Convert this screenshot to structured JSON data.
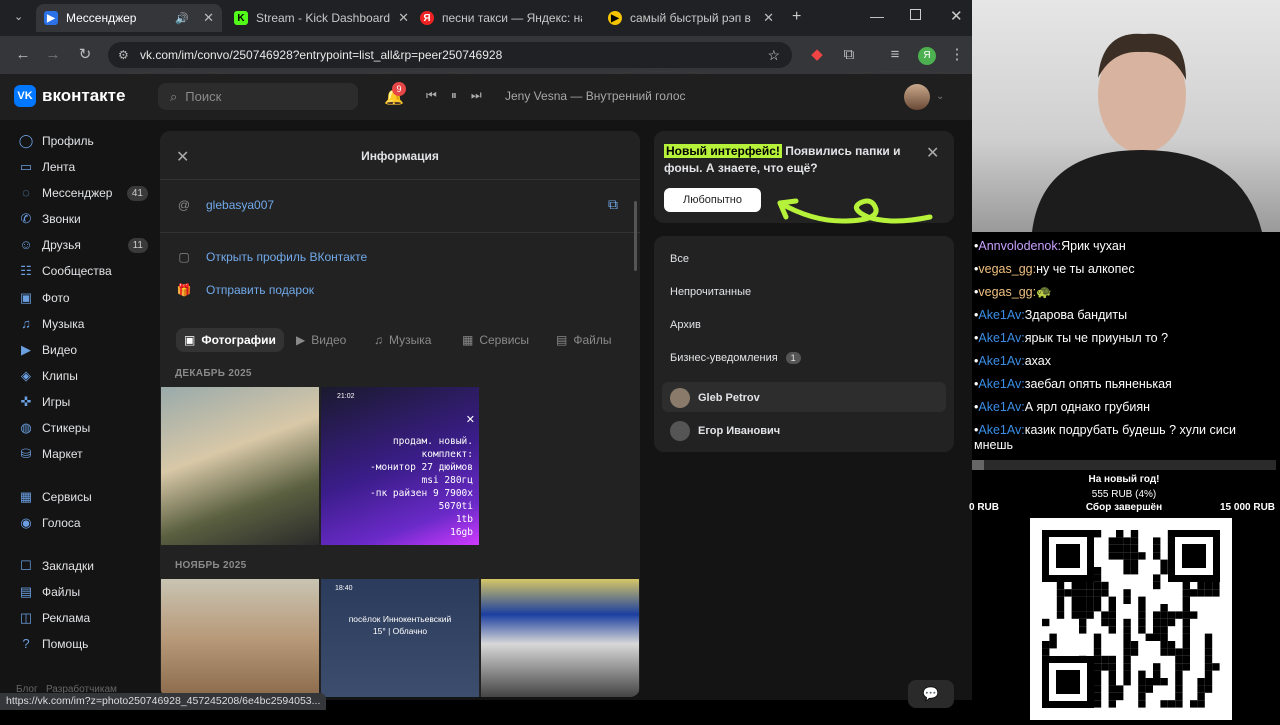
{
  "browser": {
    "tabs": [
      {
        "label": "Мессенджер",
        "color": "#2a72e6",
        "glyph": "▶"
      },
      {
        "label": "Stream - Kick Dashboard",
        "color": "#53fc18",
        "glyph": "K"
      },
      {
        "label": "песни такси — Яндекс: на",
        "color": "#e22",
        "glyph": "Я"
      },
      {
        "label": "самый быстрый рэп в Рос",
        "color": "#f5c400",
        "glyph": "▶"
      }
    ],
    "url": "vk.com/im/convo/250746928?entrypoint=list_all&rp=peer250746928",
    "status_url": "https://vk.com/im?z=photo250746928_457245208/6e4bc2594053..."
  },
  "vk": {
    "logo": "вконтакте",
    "search_placeholder": "Поиск",
    "notif_count": "9",
    "track": "Jeny Vesna — Внутренний голос",
    "sidebar": [
      {
        "label": "Профиль",
        "icon": "◯",
        "count": ""
      },
      {
        "label": "Лента",
        "icon": "▭",
        "count": ""
      },
      {
        "label": "Мессенджер",
        "icon": "◌",
        "count": "41"
      },
      {
        "label": "Звонки",
        "icon": "✆",
        "count": ""
      },
      {
        "label": "Друзья",
        "icon": "☺",
        "count": "11"
      },
      {
        "label": "Сообщества",
        "icon": "☷",
        "count": ""
      },
      {
        "label": "Фото",
        "icon": "▣",
        "count": ""
      },
      {
        "label": "Музыка",
        "icon": "♫",
        "count": ""
      },
      {
        "label": "Видео",
        "icon": "▶",
        "count": ""
      },
      {
        "label": "Клипы",
        "icon": "◈",
        "count": ""
      },
      {
        "label": "Игры",
        "icon": "✜",
        "count": ""
      },
      {
        "label": "Стикеры",
        "icon": "◍",
        "count": ""
      },
      {
        "label": "Маркет",
        "icon": "⛁",
        "count": ""
      },
      {
        "label": "Сервисы",
        "icon": "▦",
        "count": ""
      },
      {
        "label": "Голоса",
        "icon": "◉",
        "count": ""
      },
      {
        "label": "Закладки",
        "icon": "☐",
        "count": ""
      },
      {
        "label": "Файлы",
        "icon": "▤",
        "count": ""
      },
      {
        "label": "Реклама",
        "icon": "◫",
        "count": ""
      },
      {
        "label": "Помощь",
        "icon": "?",
        "count": ""
      }
    ],
    "footer": "Блог   Разработчикам",
    "panel": {
      "title": "Информация",
      "username": "glebasya007",
      "open_profile": "Открыть профиль ВКонтакте",
      "send_gift": "Отправить подарок",
      "tabs": [
        "Фотографии",
        "Видео",
        "Музыка",
        "Сервисы",
        "Файлы"
      ],
      "dates": [
        "ДЕКАБРЬ 2025",
        "НОЯБРЬ 2025"
      ],
      "photo2_time": "21:02",
      "photo2_text": "продам. новый.\nкомплект:\n-монитор 27 дюймов\nmsi 280гц\n-пк райзен 9 7900x\n5070ti\n1tb\n16gb",
      "photo4_time": "18:40",
      "photo4_text": "посёлок Иннокентьевский\n15° | Облачно"
    },
    "banner": {
      "highlight": "Новый интерфейс!",
      "rest": " Появились папки и фоны. А знаете, что ещё?",
      "button": "Любопытно"
    },
    "folders": [
      "Все",
      "Непрочитанные",
      "Архив",
      "Бизнес-уведомления"
    ],
    "folder_badge": "1",
    "chats": [
      "Gleb Petrov",
      "Егор Иванович"
    ]
  },
  "stream": {
    "chat": [
      {
        "user": "Annvolodenok:",
        "text": "Ярик чухан",
        "color": "#c8a0ff"
      },
      {
        "user": "vegas_gg:",
        "text": "ну че ты алкопес",
        "color": "#f0c080"
      },
      {
        "user": "vegas_gg:",
        "text": "🐢",
        "color": "#f0c080"
      },
      {
        "user": "Ake1Av:",
        "text": "Здарова бандиты",
        "color": "#3a8ee6"
      },
      {
        "user": "Ake1Av:",
        "text": "ярык ты че приуныл то ?",
        "color": "#3a8ee6"
      },
      {
        "user": "Ake1Av:",
        "text": "ахах",
        "color": "#3a8ee6"
      },
      {
        "user": "Ake1Av:",
        "text": "заебал опять пьяненькая",
        "color": "#3a8ee6"
      },
      {
        "user": "Ake1Av:",
        "text": "А ярл однако грубиян",
        "color": "#3a8ee6"
      },
      {
        "user": "Ake1Av:",
        "text": "казик подрубать будешь ? хули сиси мнешь",
        "color": "#3a8ee6"
      }
    ],
    "goal": {
      "title": "На новый год!",
      "amount": "555 RUB (4%)",
      "min": "0 RUB",
      "status": "Сбор завершён",
      "max": "15 000 RUB",
      "progress": 0.04
    }
  }
}
